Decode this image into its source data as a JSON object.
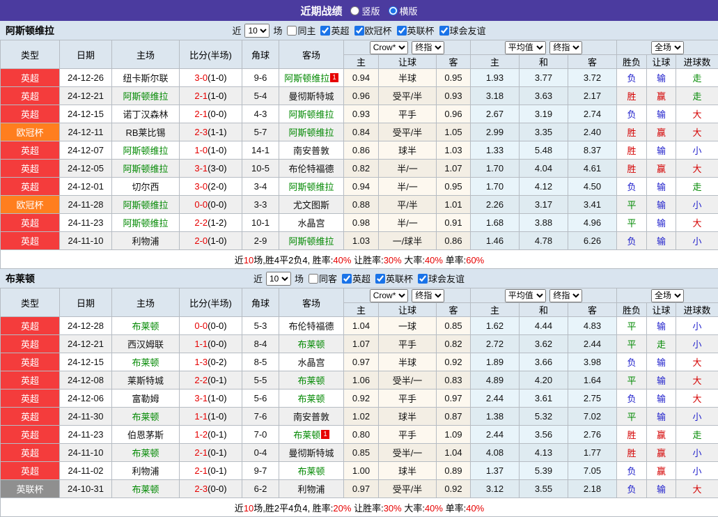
{
  "title_bar": {
    "title": "近期战绩",
    "vertical_label": "竖版",
    "horizontal_label": "横版",
    "selected": "横版"
  },
  "colors": {
    "title_bar_bg": "#4b3b9f",
    "filter_bg": "#d9e4ef",
    "header_bg": "#dce6ef",
    "focus_team": "#008800",
    "score_ft": "#e60000",
    "win_red": "#d40000",
    "draw_green": "#008800",
    "lose_blue": "#2222cc"
  },
  "league_colors": {
    "英超": "#f43c3c",
    "欧冠杯": "#ff7e1e",
    "英联杯": "#8f8f8f"
  },
  "result_color_map": {
    "胜": "red",
    "平": "green",
    "负": "blue",
    "赢": "red",
    "输": "blue",
    "走": "green",
    "大": "red",
    "小": "blue"
  },
  "tables": [
    {
      "team": "阿斯顿维拉",
      "filter": {
        "prefix": "近",
        "count": "10",
        "suffix": "场",
        "same_label": "同主",
        "same_checked": false,
        "leagues": [
          {
            "label": "英超",
            "checked": true
          },
          {
            "label": "欧冠杯",
            "checked": true
          },
          {
            "label": "英联杯",
            "checked": true
          },
          {
            "label": "球会友谊",
            "checked": true
          }
        ]
      },
      "header": {
        "type": "类型",
        "date": "日期",
        "home": "主场",
        "score": "比分(半场)",
        "corner": "角球",
        "away": "客场",
        "odds_source": "Crow*",
        "odds_period": "终指",
        "odds_home": "主",
        "odds_handicap": "让球",
        "odds_away": "客",
        "avg_source": "平均值",
        "avg_period": "终指",
        "avg_home": "主",
        "avg_draw": "和",
        "avg_away": "客",
        "scope": "全场",
        "res_outcome": "胜负",
        "res_handicap": "让球",
        "res_goals": "进球数"
      },
      "rows": [
        {
          "league": "英超",
          "date": "24-12-26",
          "home": "纽卡斯尔联",
          "home_focus": false,
          "home_badge": "",
          "ft": "3-0",
          "ht": "(1-0)",
          "corner": "9-6",
          "away": "阿斯顿维拉",
          "away_focus": true,
          "away_badge": "1",
          "o1": "0.94",
          "o2": "半球",
          "o3": "0.95",
          "a1": "1.93",
          "a2": "3.77",
          "a3": "3.72",
          "r1": "负",
          "r2": "输",
          "r3": "走"
        },
        {
          "league": "英超",
          "date": "24-12-21",
          "home": "阿斯顿维拉",
          "home_focus": true,
          "home_badge": "",
          "ft": "2-1",
          "ht": "(1-0)",
          "corner": "5-4",
          "away": "曼彻斯特城",
          "away_focus": false,
          "away_badge": "",
          "o1": "0.96",
          "o2": "受平/半",
          "o3": "0.93",
          "a1": "3.18",
          "a2": "3.63",
          "a3": "2.17",
          "r1": "胜",
          "r2": "赢",
          "r3": "走"
        },
        {
          "league": "英超",
          "date": "24-12-15",
          "home": "诺丁汉森林",
          "home_focus": false,
          "home_badge": "",
          "ft": "2-1",
          "ht": "(0-0)",
          "corner": "4-3",
          "away": "阿斯顿维拉",
          "away_focus": true,
          "away_badge": "",
          "o1": "0.93",
          "o2": "平手",
          "o3": "0.96",
          "a1": "2.67",
          "a2": "3.19",
          "a3": "2.74",
          "r1": "负",
          "r2": "输",
          "r3": "大"
        },
        {
          "league": "欧冠杯",
          "date": "24-12-11",
          "home": "RB莱比锡",
          "home_focus": false,
          "home_badge": "",
          "ft": "2-3",
          "ht": "(1-1)",
          "corner": "5-7",
          "away": "阿斯顿维拉",
          "away_focus": true,
          "away_badge": "",
          "o1": "0.84",
          "o2": "受平/半",
          "o3": "1.05",
          "a1": "2.99",
          "a2": "3.35",
          "a3": "2.40",
          "r1": "胜",
          "r2": "赢",
          "r3": "大"
        },
        {
          "league": "英超",
          "date": "24-12-07",
          "home": "阿斯顿维拉",
          "home_focus": true,
          "home_badge": "",
          "ft": "1-0",
          "ht": "(1-0)",
          "corner": "14-1",
          "away": "南安普敦",
          "away_focus": false,
          "away_badge": "",
          "o1": "0.86",
          "o2": "球半",
          "o3": "1.03",
          "a1": "1.33",
          "a2": "5.48",
          "a3": "8.37",
          "r1": "胜",
          "r2": "输",
          "r3": "小"
        },
        {
          "league": "英超",
          "date": "24-12-05",
          "home": "阿斯顿维拉",
          "home_focus": true,
          "home_badge": "",
          "ft": "3-1",
          "ht": "(3-0)",
          "corner": "10-5",
          "away": "布伦特福德",
          "away_focus": false,
          "away_badge": "",
          "o1": "0.82",
          "o2": "半/一",
          "o3": "1.07",
          "a1": "1.70",
          "a2": "4.04",
          "a3": "4.61",
          "r1": "胜",
          "r2": "赢",
          "r3": "大"
        },
        {
          "league": "英超",
          "date": "24-12-01",
          "home": "切尔西",
          "home_focus": false,
          "home_badge": "",
          "ft": "3-0",
          "ht": "(2-0)",
          "corner": "3-4",
          "away": "阿斯顿维拉",
          "away_focus": true,
          "away_badge": "",
          "o1": "0.94",
          "o2": "半/一",
          "o3": "0.95",
          "a1": "1.70",
          "a2": "4.12",
          "a3": "4.50",
          "r1": "负",
          "r2": "输",
          "r3": "走"
        },
        {
          "league": "欧冠杯",
          "date": "24-11-28",
          "home": "阿斯顿维拉",
          "home_focus": true,
          "home_badge": "",
          "ft": "0-0",
          "ht": "(0-0)",
          "corner": "3-3",
          "away": "尤文图斯",
          "away_focus": false,
          "away_badge": "",
          "o1": "0.88",
          "o2": "平/半",
          "o3": "1.01",
          "a1": "2.26",
          "a2": "3.17",
          "a3": "3.41",
          "r1": "平",
          "r2": "输",
          "r3": "小"
        },
        {
          "league": "英超",
          "date": "24-11-23",
          "home": "阿斯顿维拉",
          "home_focus": true,
          "home_badge": "",
          "ft": "2-2",
          "ht": "(1-2)",
          "corner": "10-1",
          "away": "水晶宫",
          "away_focus": false,
          "away_badge": "",
          "o1": "0.98",
          "o2": "半/一",
          "o3": "0.91",
          "a1": "1.68",
          "a2": "3.88",
          "a3": "4.96",
          "r1": "平",
          "r2": "输",
          "r3": "大"
        },
        {
          "league": "英超",
          "date": "24-11-10",
          "home": "利物浦",
          "home_focus": false,
          "home_badge": "",
          "ft": "2-0",
          "ht": "(1-0)",
          "corner": "2-9",
          "away": "阿斯顿维拉",
          "away_focus": true,
          "away_badge": "",
          "o1": "1.03",
          "o2": "一/球半",
          "o3": "0.86",
          "a1": "1.46",
          "a2": "4.78",
          "a3": "6.26",
          "r1": "负",
          "r2": "输",
          "r3": "小"
        }
      ],
      "summary_segments": [
        [
          "近",
          "black"
        ],
        [
          "10",
          "red"
        ],
        [
          "场,胜4平2负4, 胜率:",
          "black"
        ],
        [
          "40%",
          "red"
        ],
        [
          " 让胜率:",
          "black"
        ],
        [
          "30%",
          "red"
        ],
        [
          " 大率:",
          "black"
        ],
        [
          "40%",
          "red"
        ],
        [
          " 单率:",
          "black"
        ],
        [
          "60%",
          "red"
        ]
      ]
    },
    {
      "team": "布莱顿",
      "filter": {
        "prefix": "近",
        "count": "10",
        "suffix": "场",
        "same_label": "同客",
        "same_checked": false,
        "leagues": [
          {
            "label": "英超",
            "checked": true
          },
          {
            "label": "英联杯",
            "checked": true
          },
          {
            "label": "球会友谊",
            "checked": true
          }
        ]
      },
      "header": {
        "type": "类型",
        "date": "日期",
        "home": "主场",
        "score": "比分(半场)",
        "corner": "角球",
        "away": "客场",
        "odds_source": "Crow*",
        "odds_period": "终指",
        "odds_home": "主",
        "odds_handicap": "让球",
        "odds_away": "客",
        "avg_source": "平均值",
        "avg_period": "终指",
        "avg_home": "主",
        "avg_draw": "和",
        "avg_away": "客",
        "scope": "全场",
        "res_outcome": "胜负",
        "res_handicap": "让球",
        "res_goals": "进球数"
      },
      "rows": [
        {
          "league": "英超",
          "date": "24-12-28",
          "home": "布莱顿",
          "home_focus": true,
          "home_badge": "",
          "ft": "0-0",
          "ht": "(0-0)",
          "corner": "5-3",
          "away": "布伦特福德",
          "away_focus": false,
          "away_badge": "",
          "o1": "1.04",
          "o2": "一球",
          "o3": "0.85",
          "a1": "1.62",
          "a2": "4.44",
          "a3": "4.83",
          "r1": "平",
          "r2": "输",
          "r3": "小"
        },
        {
          "league": "英超",
          "date": "24-12-21",
          "home": "西汉姆联",
          "home_focus": false,
          "home_badge": "",
          "ft": "1-1",
          "ht": "(0-0)",
          "corner": "8-4",
          "away": "布莱顿",
          "away_focus": true,
          "away_badge": "",
          "o1": "1.07",
          "o2": "平手",
          "o3": "0.82",
          "a1": "2.72",
          "a2": "3.62",
          "a3": "2.44",
          "r1": "平",
          "r2": "走",
          "r3": "小"
        },
        {
          "league": "英超",
          "date": "24-12-15",
          "home": "布莱顿",
          "home_focus": true,
          "home_badge": "",
          "ft": "1-3",
          "ht": "(0-2)",
          "corner": "8-5",
          "away": "水晶宫",
          "away_focus": false,
          "away_badge": "",
          "o1": "0.97",
          "o2": "半球",
          "o3": "0.92",
          "a1": "1.89",
          "a2": "3.66",
          "a3": "3.98",
          "r1": "负",
          "r2": "输",
          "r3": "大"
        },
        {
          "league": "英超",
          "date": "24-12-08",
          "home": "莱斯特城",
          "home_focus": false,
          "home_badge": "",
          "ft": "2-2",
          "ht": "(0-1)",
          "corner": "5-5",
          "away": "布莱顿",
          "away_focus": true,
          "away_badge": "",
          "o1": "1.06",
          "o2": "受半/一",
          "o3": "0.83",
          "a1": "4.89",
          "a2": "4.20",
          "a3": "1.64",
          "r1": "平",
          "r2": "输",
          "r3": "大"
        },
        {
          "league": "英超",
          "date": "24-12-06",
          "home": "富勒姆",
          "home_focus": false,
          "home_badge": "",
          "ft": "3-1",
          "ht": "(1-0)",
          "corner": "5-6",
          "away": "布莱顿",
          "away_focus": true,
          "away_badge": "",
          "o1": "0.92",
          "o2": "平手",
          "o3": "0.97",
          "a1": "2.44",
          "a2": "3.61",
          "a3": "2.75",
          "r1": "负",
          "r2": "输",
          "r3": "大"
        },
        {
          "league": "英超",
          "date": "24-11-30",
          "home": "布莱顿",
          "home_focus": true,
          "home_badge": "",
          "ft": "1-1",
          "ht": "(1-0)",
          "corner": "7-6",
          "away": "南安普敦",
          "away_focus": false,
          "away_badge": "",
          "o1": "1.02",
          "o2": "球半",
          "o3": "0.87",
          "a1": "1.38",
          "a2": "5.32",
          "a3": "7.02",
          "r1": "平",
          "r2": "输",
          "r3": "小"
        },
        {
          "league": "英超",
          "date": "24-11-23",
          "home": "伯恩茅斯",
          "home_focus": false,
          "home_badge": "",
          "ft": "1-2",
          "ht": "(0-1)",
          "corner": "7-0",
          "away": "布莱顿",
          "away_focus": true,
          "away_badge": "1",
          "o1": "0.80",
          "o2": "平手",
          "o3": "1.09",
          "a1": "2.44",
          "a2": "3.56",
          "a3": "2.76",
          "r1": "胜",
          "r2": "赢",
          "r3": "走"
        },
        {
          "league": "英超",
          "date": "24-11-10",
          "home": "布莱顿",
          "home_focus": true,
          "home_badge": "",
          "ft": "2-1",
          "ht": "(0-1)",
          "corner": "0-4",
          "away": "曼彻斯特城",
          "away_focus": false,
          "away_badge": "",
          "o1": "0.85",
          "o2": "受半/一",
          "o3": "1.04",
          "a1": "4.08",
          "a2": "4.13",
          "a3": "1.77",
          "r1": "胜",
          "r2": "赢",
          "r3": "小"
        },
        {
          "league": "英超",
          "date": "24-11-02",
          "home": "利物浦",
          "home_focus": false,
          "home_badge": "",
          "ft": "2-1",
          "ht": "(0-1)",
          "corner": "9-7",
          "away": "布莱顿",
          "away_focus": true,
          "away_badge": "",
          "o1": "1.00",
          "o2": "球半",
          "o3": "0.89",
          "a1": "1.37",
          "a2": "5.39",
          "a3": "7.05",
          "r1": "负",
          "r2": "赢",
          "r3": "小"
        },
        {
          "league": "英联杯",
          "date": "24-10-31",
          "home": "布莱顿",
          "home_focus": true,
          "home_badge": "",
          "ft": "2-3",
          "ht": "(0-0)",
          "corner": "6-2",
          "away": "利物浦",
          "away_focus": false,
          "away_badge": "",
          "o1": "0.97",
          "o2": "受平/半",
          "o3": "0.92",
          "a1": "3.12",
          "a2": "3.55",
          "a3": "2.18",
          "r1": "负",
          "r2": "输",
          "r3": "大"
        }
      ],
      "summary_segments": [
        [
          "近",
          "black"
        ],
        [
          "10",
          "red"
        ],
        [
          "场,胜2平4负4, 胜率:",
          "black"
        ],
        [
          "20%",
          "red"
        ],
        [
          " 让胜率:",
          "black"
        ],
        [
          "30%",
          "red"
        ],
        [
          " 大率:",
          "black"
        ],
        [
          "40%",
          "red"
        ],
        [
          " 单率:",
          "black"
        ],
        [
          "40%",
          "red"
        ]
      ]
    }
  ]
}
